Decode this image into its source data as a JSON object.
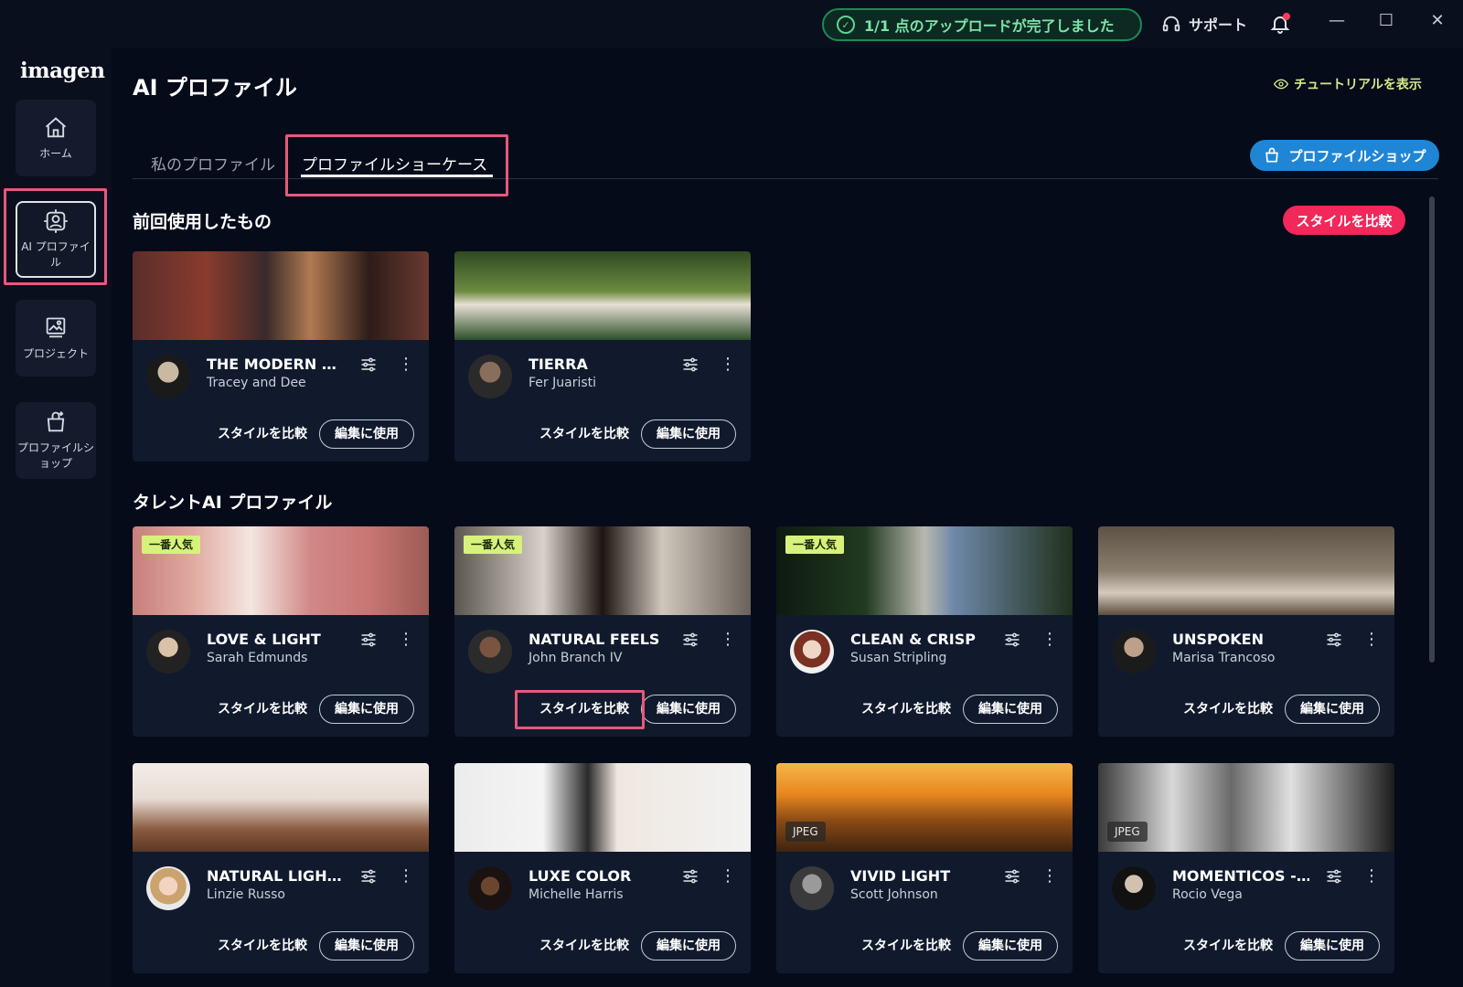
{
  "titlebar": {
    "upload_status": "1/1 点のアップロードが完了しました",
    "support_label": "サポート",
    "window_controls": [
      "—",
      "☐",
      "✕"
    ]
  },
  "sidebar": {
    "logo": "imagen",
    "items": [
      {
        "label": "ホーム",
        "icon": "home-icon"
      },
      {
        "label": "AI プロファイル",
        "icon": "ai-profile-icon",
        "active": true
      },
      {
        "label": "プロジェクト",
        "icon": "project-icon"
      },
      {
        "label": "プロファイルショップ",
        "icon": "shop-icon"
      }
    ]
  },
  "header": {
    "title": "AI プロファイル",
    "tutorial_label": "チュートリアルを表示",
    "tabs": [
      {
        "label": "私のプロファイル",
        "active": false
      },
      {
        "label": "プロファイルショーケース",
        "active": true
      }
    ],
    "shop_button": "プロファイルショップ"
  },
  "sections": {
    "recent": {
      "title": "前回使用したもの",
      "compare_button": "スタイルを比較"
    },
    "talent": {
      "title": "タレントAI プロファイル"
    }
  },
  "card_actions": {
    "compare": "スタイルを比較",
    "use": "編集に使用"
  },
  "cards": [
    {
      "name": "THE MODERN …",
      "author": "Tracey and Dee",
      "badge": "",
      "jpeg": ""
    },
    {
      "name": "TIERRA",
      "author": "Fer Juaristi",
      "badge": "",
      "jpeg": ""
    },
    {
      "name": "LOVE & LIGHT",
      "author": "Sarah Edmunds",
      "badge": "一番人気",
      "jpeg": ""
    },
    {
      "name": "NATURAL FEELS",
      "author": "John Branch IV",
      "badge": "一番人気",
      "jpeg": ""
    },
    {
      "name": "CLEAN & CRISP",
      "author": "Susan Stripling",
      "badge": "一番人気",
      "jpeg": ""
    },
    {
      "name": "UNSPOKEN",
      "author": "Marisa Trancoso",
      "badge": "",
      "jpeg": ""
    },
    {
      "name": "NATURAL LIGH…",
      "author": "Linzie Russo",
      "badge": "",
      "jpeg": ""
    },
    {
      "name": "LUXE COLOR",
      "author": "Michelle Harris",
      "badge": "",
      "jpeg": ""
    },
    {
      "name": "VIVID LIGHT",
      "author": "Scott Johnson",
      "badge": "",
      "jpeg": "JPEG"
    },
    {
      "name": "MOMENTICOS -…",
      "author": "Rocio Vega",
      "badge": "",
      "jpeg": "JPEG"
    }
  ],
  "colors": {
    "accent_blue": "#1f86d6",
    "accent_pink": "#f2275a",
    "badge_green": "#d6f27b",
    "highlight": "#e8587b",
    "background": "#050b19"
  }
}
